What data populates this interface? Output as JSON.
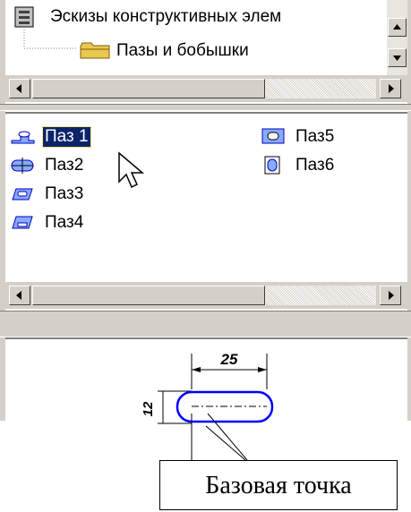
{
  "tree": {
    "items": [
      {
        "label": "Эскизы конструктивных элем",
        "icon": "sketch-folder-icon"
      },
      {
        "label": "Пазы и бобышки",
        "icon": "folder-icon"
      }
    ]
  },
  "list": {
    "items": [
      {
        "label": "Паз 1",
        "selected": true
      },
      {
        "label": "Паз2"
      },
      {
        "label": "Паз3"
      },
      {
        "label": "Паз4"
      },
      {
        "label": "Паз5"
      },
      {
        "label": "Паз6"
      }
    ]
  },
  "preview": {
    "dimension_width": "25",
    "dimension_height": "12"
  },
  "callout": {
    "label": "Базовая точка"
  },
  "colors": {
    "selection": "#0a246a",
    "icon_blue": "#0000ff",
    "chrome": "#d4d0c8"
  }
}
